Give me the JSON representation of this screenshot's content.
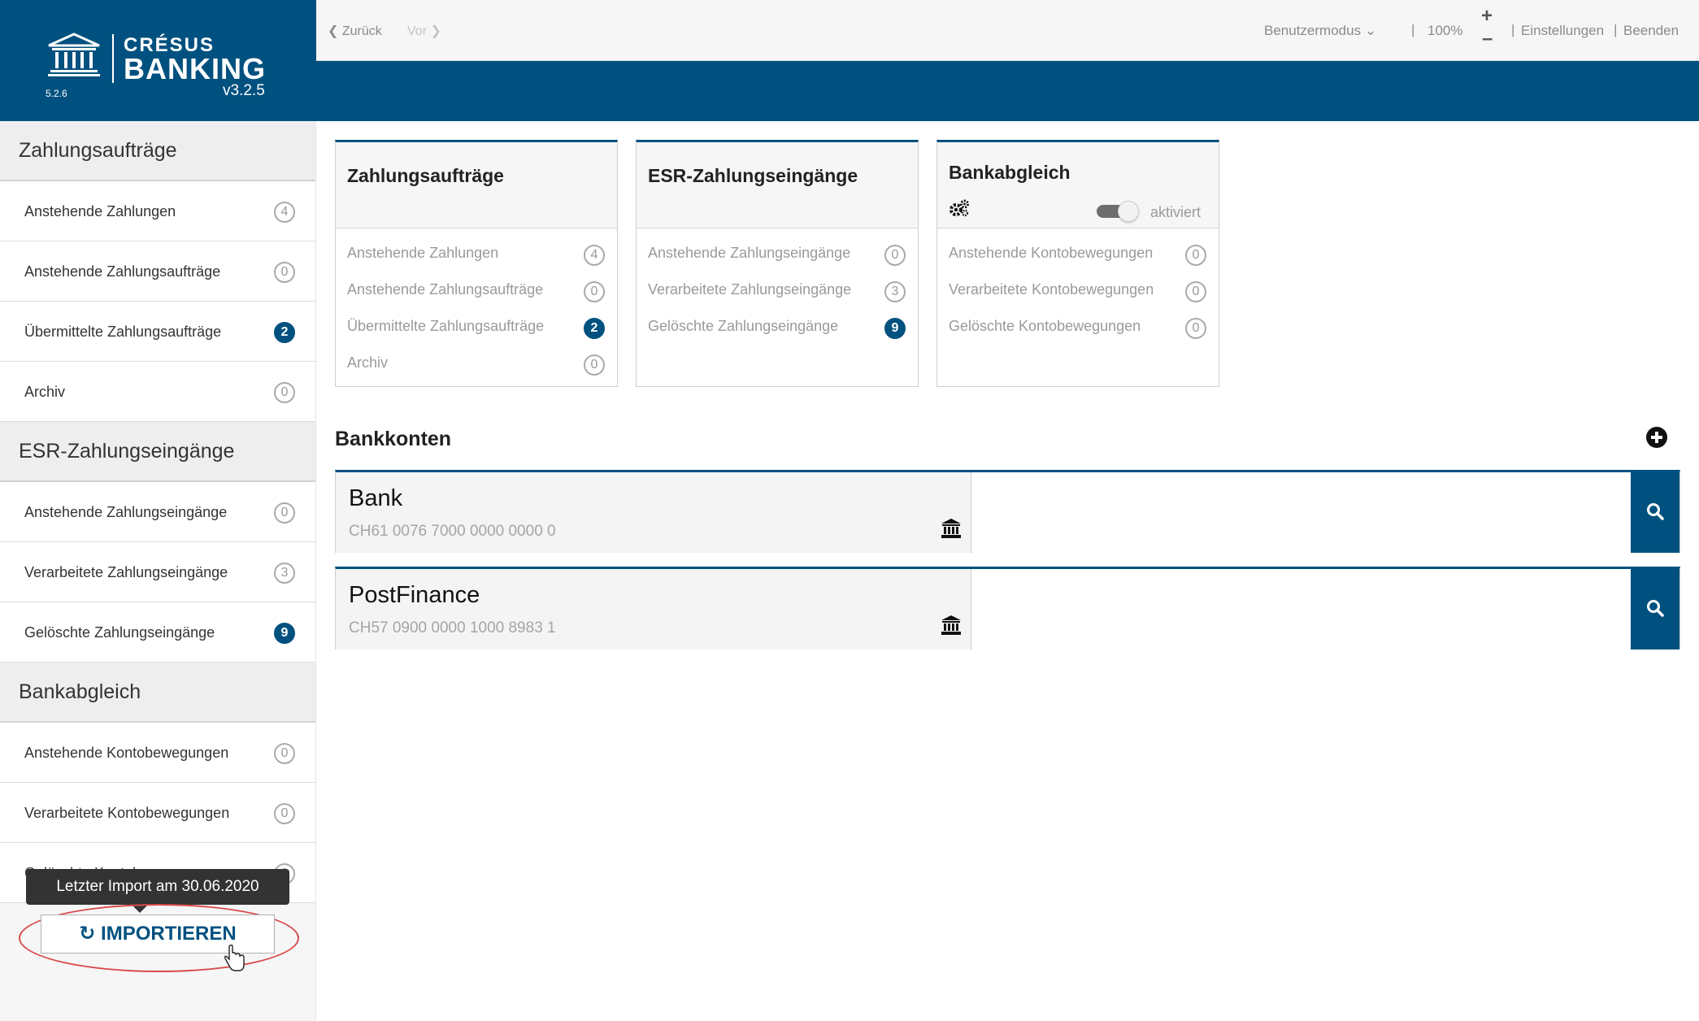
{
  "app": {
    "brand_top": "CRÉSUS",
    "brand_main": "BANKING",
    "version_small": "5.2.6",
    "version": "v3.2.5",
    "accent": "#00517f"
  },
  "topbar": {
    "back": "Zurück",
    "forward": "Vor",
    "mode": "Benutzermodus",
    "zoom": "100%",
    "zoom_in": "+",
    "zoom_out": "–",
    "separator": "|",
    "settings": "Einstellungen",
    "quit": "Beenden"
  },
  "sidebar": {
    "groups": [
      {
        "title": "Zahlungsaufträge",
        "items": [
          {
            "label": "Anstehende Zahlungen",
            "count": "4",
            "highlight": false
          },
          {
            "label": "Anstehende Zahlungsaufträge",
            "count": "0",
            "highlight": false
          },
          {
            "label": "Übermittelte Zahlungsaufträge",
            "count": "2",
            "highlight": true
          },
          {
            "label": "Archiv",
            "count": "0",
            "highlight": false
          }
        ]
      },
      {
        "title": "ESR-Zahlungseingänge",
        "items": [
          {
            "label": "Anstehende Zahlungseingänge",
            "count": "0",
            "highlight": false
          },
          {
            "label": "Verarbeitete Zahlungseingänge",
            "count": "3",
            "highlight": false
          },
          {
            "label": "Gelöschte Zahlungseingänge",
            "count": "9",
            "highlight": true
          }
        ]
      },
      {
        "title": "Bankabgleich",
        "items": [
          {
            "label": "Anstehende Kontobewegungen",
            "count": "0",
            "highlight": false
          },
          {
            "label": "Verarbeitete Kontobewegungen",
            "count": "0",
            "highlight": false
          }
        ]
      }
    ],
    "partial_item": {
      "label": "Gelöschte Kontobewegungen",
      "count": "0"
    },
    "tooltip": "Letzter Import am  30.06.2020",
    "import_button": "IMPORTIEREN"
  },
  "cards": [
    {
      "title": "Zahlungsaufträge",
      "rows": [
        {
          "label": "Anstehende Zahlungen",
          "count": "4",
          "highlight": false
        },
        {
          "label": "Anstehende Zahlungsaufträge",
          "count": "0",
          "highlight": false
        },
        {
          "label": "Übermittelte Zahlungsaufträge",
          "count": "2",
          "highlight": true
        },
        {
          "label": "Archiv",
          "count": "0",
          "highlight": false
        }
      ]
    },
    {
      "title": "ESR-Zahlungseingänge",
      "rows": [
        {
          "label": "Anstehende Zahlungseingänge",
          "count": "0",
          "highlight": false
        },
        {
          "label": "Verarbeitete Zahlungseingänge",
          "count": "3",
          "highlight": false
        },
        {
          "label": "Gelöschte Zahlungseingänge",
          "count": "9",
          "highlight": true
        }
      ]
    },
    {
      "title": "Bankabgleich",
      "toggle_label": "aktiviert",
      "toggle_on": true,
      "rows": [
        {
          "label": "Anstehende Kontobewegungen",
          "count": "0",
          "highlight": false
        },
        {
          "label": "Verarbeitete Kontobewegungen",
          "count": "0",
          "highlight": false
        },
        {
          "label": "Gelöschte Kontobewegungen",
          "count": "0",
          "highlight": false
        }
      ]
    }
  ],
  "accounts": {
    "title": "Bankkonten",
    "items": [
      {
        "name": "Bank",
        "iban": "CH61 0076 7000 0000 0000 0"
      },
      {
        "name": "PostFinance",
        "iban": "CH57 0900 0000 1000 8983 1"
      }
    ]
  }
}
